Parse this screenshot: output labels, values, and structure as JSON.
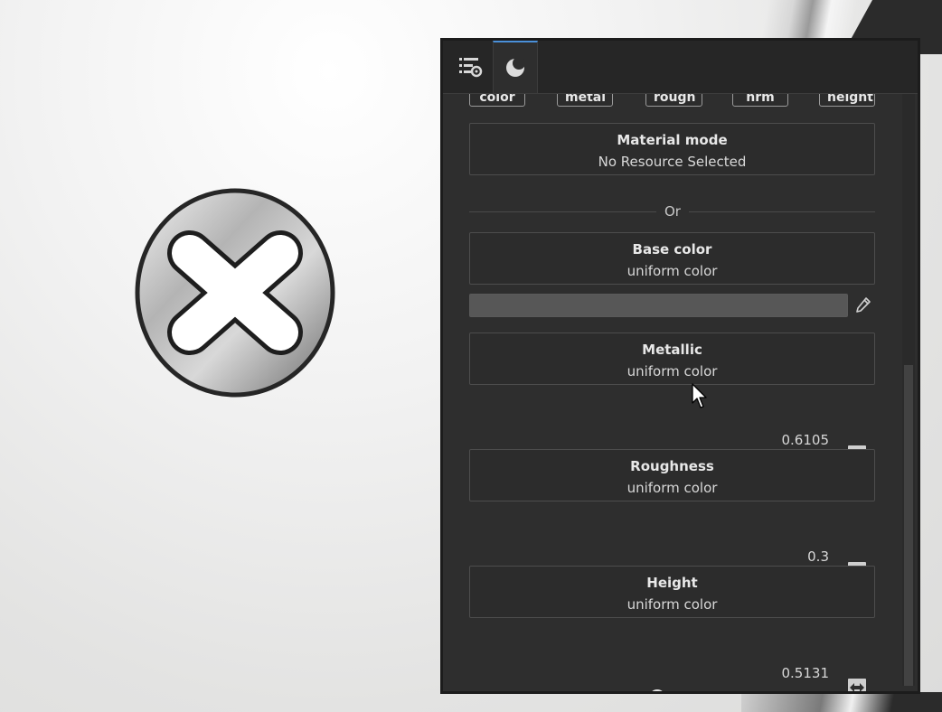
{
  "tabs": [
    {
      "icon": "list-settings-icon"
    },
    {
      "icon": "material-sphere-icon"
    }
  ],
  "channel_chips": [
    "color",
    "metal",
    "rough",
    "nrm",
    "height"
  ],
  "material_mode": {
    "title": "Material mode",
    "value": "No Resource Selected"
  },
  "separator_label": "Or",
  "base_color": {
    "title": "Base color",
    "value": "uniform color",
    "swatch": "#575757"
  },
  "metallic": {
    "title": "Metallic",
    "value": "uniform color",
    "number": "0.6105",
    "fraction": 0.6105
  },
  "roughness": {
    "title": "Roughness",
    "value": "uniform color",
    "number": "0.3",
    "fraction": 0.3
  },
  "height": {
    "title": "Height",
    "value": "uniform color",
    "number": "0.5131",
    "fraction": 0.5131
  },
  "colors": {
    "panel": "#2e2e2e",
    "accent": "#4a90d9"
  }
}
